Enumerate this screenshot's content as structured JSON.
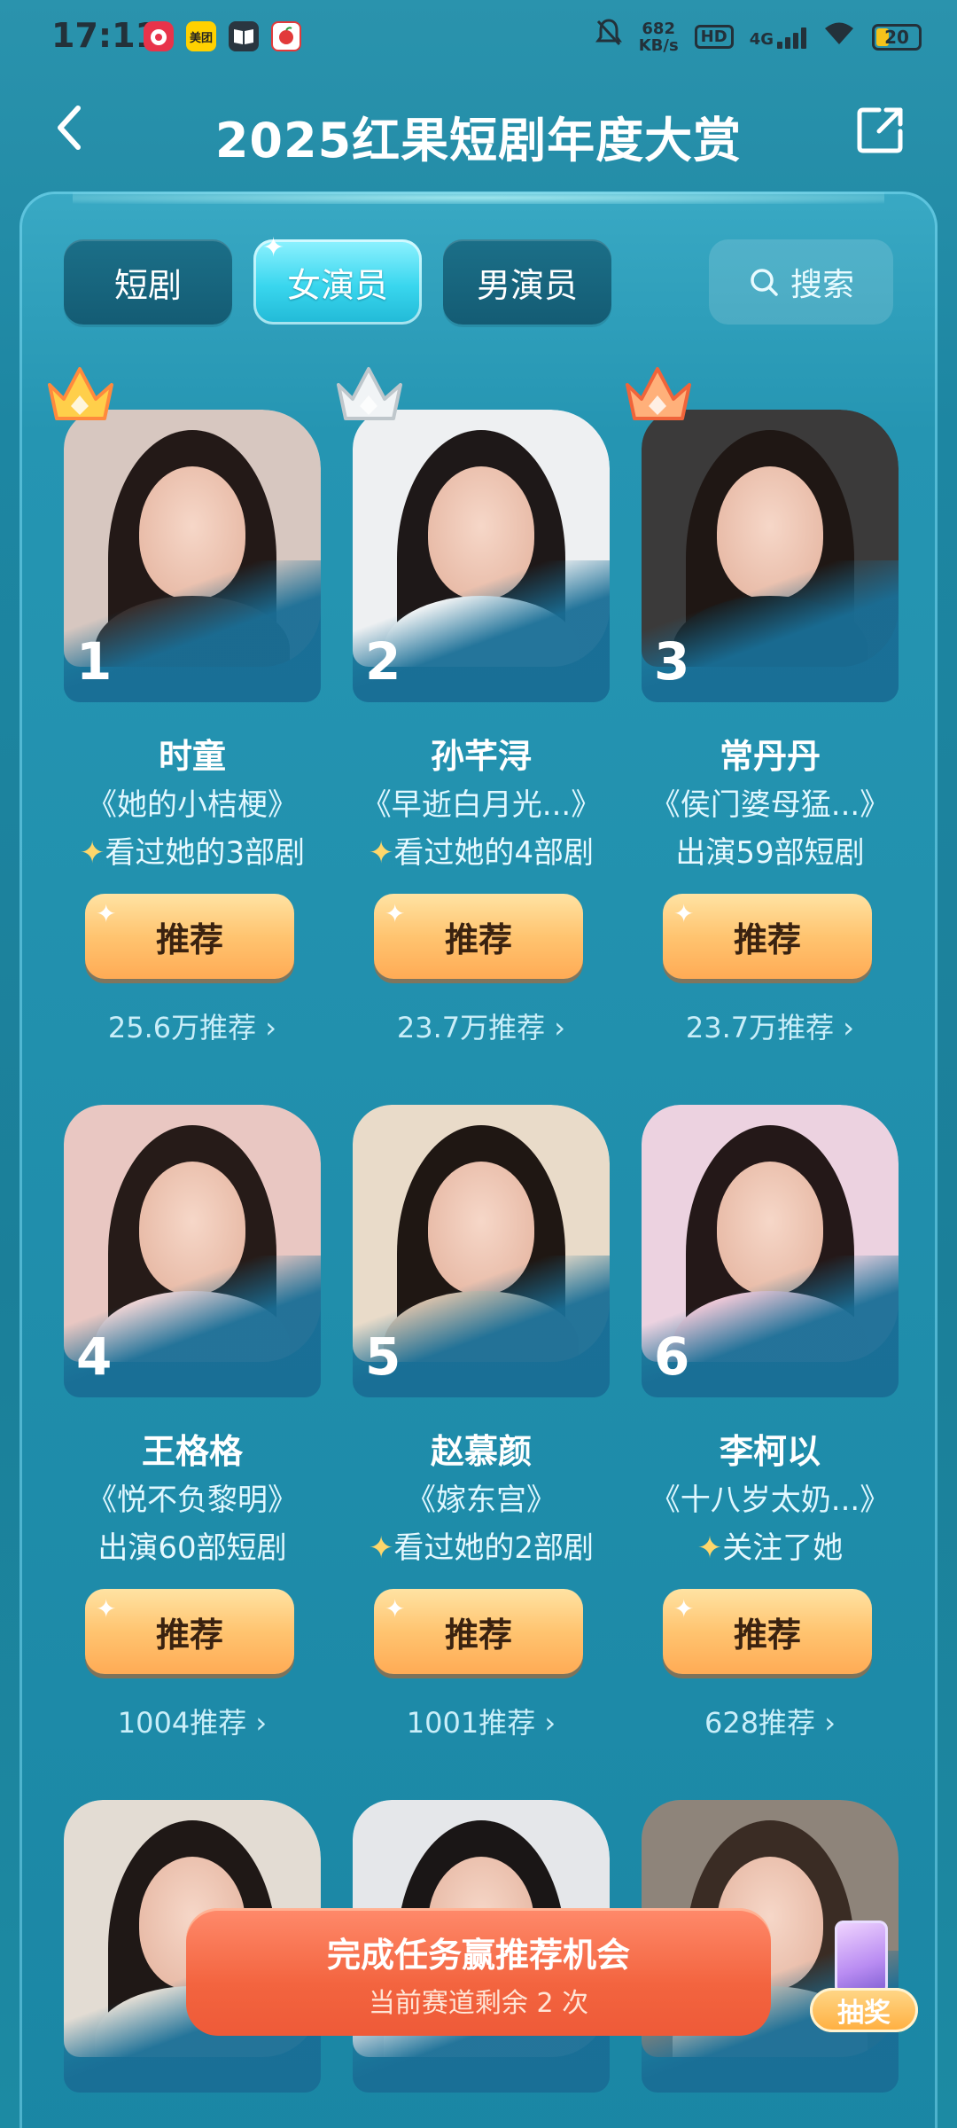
{
  "status_bar": {
    "time": "17:11",
    "app_icons": [
      "weibo-icon",
      "meituan-icon",
      "reader-icon",
      "hongguo-icon"
    ],
    "meituan_label": "美团",
    "net_speed_value": "682",
    "net_speed_unit": "KB/s",
    "hd_label": "HD",
    "network_label": "4G",
    "battery": "20",
    "battery_level_fraction": 0.2
  },
  "header": {
    "title": "2025红果短剧年度大赏",
    "back_icon": "chevron-left-icon",
    "share_icon": "share-icon"
  },
  "tabs": [
    {
      "label": "短剧",
      "active": false
    },
    {
      "label": "女演员",
      "active": true
    },
    {
      "label": "男演员",
      "active": false
    }
  ],
  "search": {
    "label": "搜索",
    "icon": "search-icon"
  },
  "actresses": [
    {
      "rank": "1",
      "name": "时童",
      "drama": "《她的小桔梗》",
      "note_star": true,
      "note": "看过她的3部剧",
      "button": "推荐",
      "count": "25.6万推荐 ›",
      "crown": "gold",
      "photo_colors": {
        "bg": "#d7c7c0",
        "hair": "#231917",
        "body": "#3a2d2a"
      }
    },
    {
      "rank": "2",
      "name": "孙芊浔",
      "drama": "《早逝白月光...》",
      "note_star": true,
      "note": "看过她的4部剧",
      "button": "推荐",
      "count": "23.7万推荐 ›",
      "crown": "silver",
      "photo_colors": {
        "bg": "#eef0f2",
        "hair": "#1e1818",
        "body": "#f7f7f7"
      }
    },
    {
      "rank": "3",
      "name": "常丹丹",
      "drama": "《侯门婆母猛...》",
      "note_star": false,
      "note": "出演59部短剧",
      "button": "推荐",
      "count": "23.7万推荐 ›",
      "crown": "bronze",
      "photo_colors": {
        "bg": "#3b3a3a",
        "hair": "#1f1714",
        "body": "#1b1b1b"
      }
    },
    {
      "rank": "4",
      "name": "王格格",
      "drama": "《悦不负黎明》",
      "note_star": false,
      "note": "出演60部短剧",
      "button": "推荐",
      "count": "1004推荐 ›",
      "crown": "",
      "photo_colors": {
        "bg": "#e9c7c2",
        "hair": "#261b18",
        "body": "#f4d6d6"
      }
    },
    {
      "rank": "5",
      "name": "赵慕颜",
      "drama": "《嫁东宫》",
      "note_star": true,
      "note": "看过她的2部剧",
      "button": "推荐",
      "count": "1001推荐 ›",
      "crown": "",
      "photo_colors": {
        "bg": "#e9dbc9",
        "hair": "#1f1713",
        "body": "#d8c1ab"
      }
    },
    {
      "rank": "6",
      "name": "李柯以",
      "drama": "《十八岁太奶...》",
      "note_star": true,
      "note": "关注了她",
      "button": "推荐",
      "count": "628推荐 ›",
      "crown": "",
      "photo_colors": {
        "bg": "#ecd2e0",
        "hair": "#241818",
        "body": "#f2c9d8"
      }
    }
  ],
  "partial_cards": [
    {
      "photo_colors": {
        "bg": "#e3dcd3",
        "hair": "#1f1816",
        "body": "#e8e0d6"
      }
    },
    {
      "photo_colors": {
        "bg": "#e5e7ea",
        "hair": "#1a1616",
        "body": "#f0f0f0"
      }
    },
    {
      "photo_colors": {
        "bg": "#8e847a",
        "hair": "#3a2c24",
        "body": "#d9c6b6"
      }
    }
  ],
  "task_banner": {
    "title": "完成任务赢推荐机会",
    "subtitle": "当前赛道剩余 2 次"
  },
  "lottery": {
    "label": "抽奖"
  },
  "colors": {
    "accent_orange": "#ffb85d",
    "teal_bg": "#1b7f99",
    "active_tab": "#39d6ee",
    "banner": "#f3643f"
  }
}
